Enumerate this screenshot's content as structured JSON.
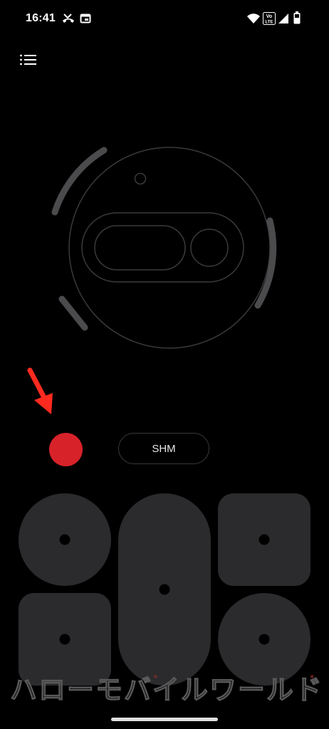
{
  "status_bar": {
    "time": "16:41",
    "icons": [
      "missed-call-icon",
      "calendar-icon",
      "wifi-icon",
      "volte-icon",
      "cell-signal-icon",
      "battery-icon"
    ],
    "volte_label": "Vo LTE"
  },
  "menu": {
    "icon": "list-menu-icon"
  },
  "controls": {
    "record_color": "#d8222a",
    "shm_label": "SHM"
  },
  "annotation": {
    "arrow_color": "#ff2a1f",
    "icon": "red-arrow-icon"
  },
  "pads": [
    {
      "name": "pad-1",
      "shape": "circle"
    },
    {
      "name": "pad-2",
      "shape": "pill"
    },
    {
      "name": "pad-3",
      "shape": "rounded-square"
    },
    {
      "name": "pad-4",
      "shape": "rounded-square"
    },
    {
      "name": "pad-5",
      "shape": "circle"
    }
  ],
  "colors": {
    "background": "#000000",
    "pad": "#2b2b2d",
    "glyph_arc": "#4b4b4d",
    "outline": "#3a3a3a"
  },
  "watermark": {
    "text": "ハローモバイルワールド"
  }
}
